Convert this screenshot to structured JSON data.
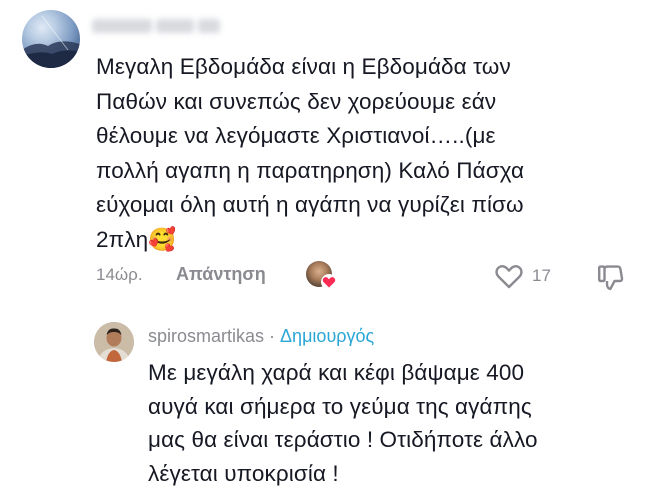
{
  "comment": {
    "text": "Μεγαλη Εβδομάδα είναι η Εβδομάδα των\nΠαθών και συνεπώς δεν χορεύουμε εάν\nθέλουμε να λεγόμαστε Χριστιανοί…..(με\nπολλή αγαπη η παρατηρηση) Καλό Πάσχα\nεύχομαι όλη αυτή η αγάπη να γυρίζει πίσω\n2πλη🥰",
    "time": "14ώρ.",
    "reply_label": "Απάντηση",
    "like_count": "17",
    "liked_by_creator": true
  },
  "reply": {
    "username": "spirosmartikas",
    "separator": "·",
    "badge": "Δημιουργός",
    "text": "Με μεγάλη χαρά και κέφι βάψαμε 400\nαυγά και σήμερα το γεύμα της αγάπης\nμας θα είναι τεράστιο ! Οτιδήποτε άλλο\nλέγεται υποκρισία !"
  },
  "colors": {
    "text": "#161823",
    "secondary": "#8a8b91",
    "creator_badge": "#2aa6d6",
    "heart": "#fe2c55"
  },
  "icons": {
    "like": "heart-outline-icon",
    "dislike": "thumbs-down-icon",
    "creator_like": "creator-heart-icon"
  }
}
